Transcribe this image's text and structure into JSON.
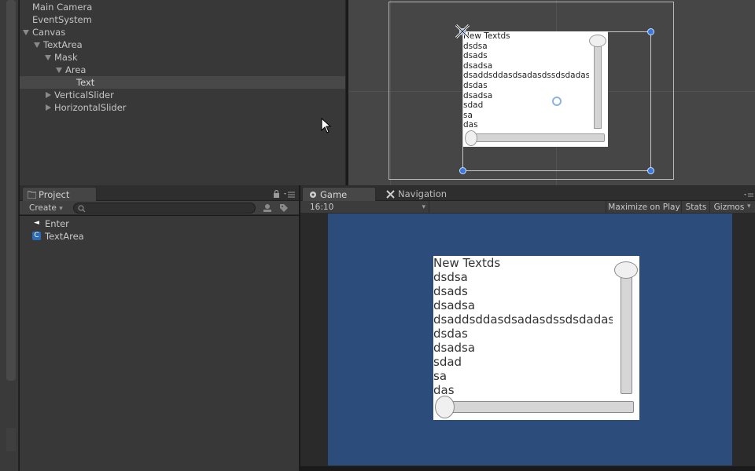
{
  "hierarchy": {
    "items": [
      {
        "label": "Main Camera"
      },
      {
        "label": "EventSystem"
      },
      {
        "label": "Canvas"
      },
      {
        "label": "TextArea"
      },
      {
        "label": "Mask"
      },
      {
        "label": "Area"
      },
      {
        "label": "Text"
      },
      {
        "label": "VerticalSlider"
      },
      {
        "label": "HorizontalSlider"
      }
    ]
  },
  "scene": {
    "text_lines": [
      "New Textds",
      "dsdsa",
      "dsads",
      "dsadsa",
      "dsaddsddasdsadasdssdsdadasd",
      "dsdas",
      "dsadsa",
      "sdad",
      "sa",
      "das"
    ]
  },
  "project": {
    "tab_label": "Project",
    "create_label": "Create",
    "search_placeholder": "",
    "items": [
      {
        "label": "Enter",
        "icon": "unity-scene-icon"
      },
      {
        "label": "TextArea",
        "icon": "csharp-script-icon"
      }
    ]
  },
  "game": {
    "tab_label": "Game",
    "nav_tab_label": "Navigation",
    "aspect": "16:10",
    "tools": {
      "maximize": "Maximize on Play",
      "stats": "Stats",
      "gizmos": "Gizmos"
    },
    "text_lines": [
      "New Textds",
      "dsdsa",
      "dsads",
      "dsadsa",
      "dsaddsddasdsadasdssdsdadasd",
      "dsdas",
      "dsadsa",
      "sdad",
      "sa",
      "das"
    ]
  },
  "colors": {
    "game_background": "#2c4c7c",
    "panel": "#383838",
    "selection": "#484848",
    "rect_handle": "#3a7adf"
  }
}
